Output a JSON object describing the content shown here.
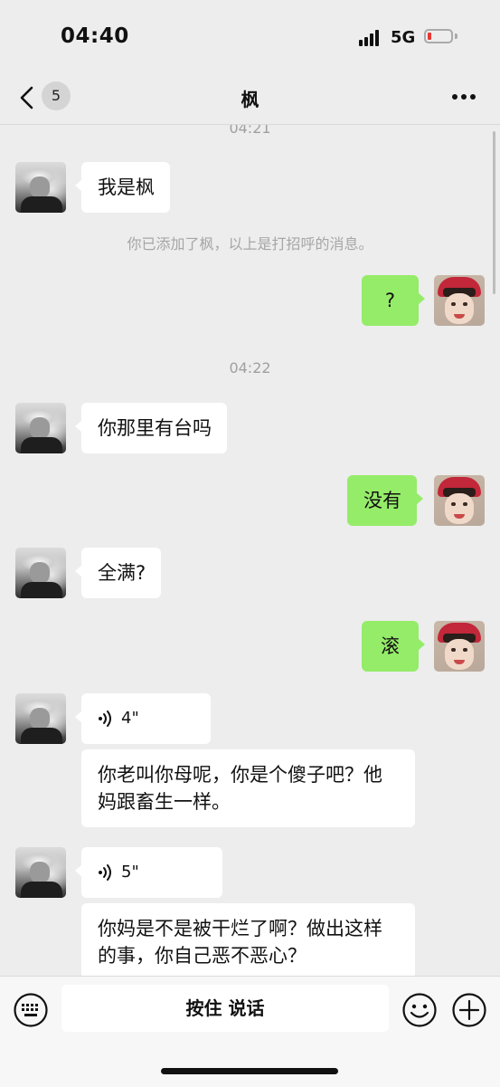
{
  "status_bar": {
    "time": "04:40",
    "network": "5G",
    "battery_level": 0.1,
    "battery_color": "#e53935"
  },
  "header": {
    "unread_count": "5",
    "title": "枫"
  },
  "icons": {
    "back": "chevron-left-icon",
    "more": "more-dots-icon",
    "keyboard": "keyboard-icon",
    "emoji": "emoji-icon",
    "plus": "plus-icon",
    "voice": "voice-wave-icon"
  },
  "messages": {
    "ts_top": "04:21",
    "m1": "我是枫",
    "system_added": "你已添加了枫，以上是打招呼的消息。",
    "m2": "?",
    "ts_2": "04:22",
    "m3": "你那里有台吗",
    "m4": "没有",
    "m5": "全满?",
    "m6": "滚",
    "voice1_duration": "4\"",
    "voice1_text": "你老叫你母呢，你是个傻子吧？他妈跟畜生一样。",
    "voice2_duration": "5\"",
    "voice2_text": "你妈是不是被干烂了啊？做出这样的事，你自己恶不恶心？"
  },
  "input_bar": {
    "hold_to_talk": "按住 说话"
  },
  "colors": {
    "background": "#ededed",
    "self_bubble": "#95ec69",
    "other_bubble": "#ffffff"
  }
}
